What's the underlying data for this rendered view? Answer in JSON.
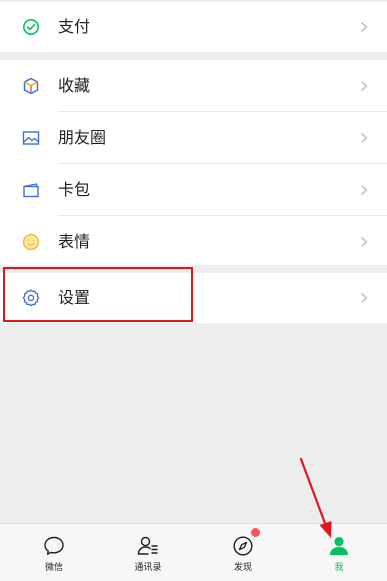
{
  "menu": {
    "pay": {
      "label": "支付",
      "icon": "pay-check-icon"
    },
    "favorites": {
      "label": "收藏",
      "icon": "cube-icon"
    },
    "moments": {
      "label": "朋友圈",
      "icon": "picture-icon"
    },
    "cards": {
      "label": "卡包",
      "icon": "card-wallet-icon"
    },
    "stickers": {
      "label": "表情",
      "icon": "smiley-icon"
    },
    "settings": {
      "label": "设置",
      "icon": "gear-icon"
    }
  },
  "tabbar": {
    "chats": {
      "label": "微信",
      "icon": "chat-bubble-icon"
    },
    "contacts": {
      "label": "通讯录",
      "icon": "contacts-icon"
    },
    "discover": {
      "label": "发现",
      "icon": "compass-icon",
      "badge": "red-dot"
    },
    "me": {
      "label": "我",
      "icon": "person-icon",
      "active": true
    }
  },
  "colors": {
    "accent": "#07c160",
    "background": "#ededed",
    "highlight_box": "#e0161b",
    "arrow": "#e0161b",
    "badge": "#f25a5a"
  }
}
